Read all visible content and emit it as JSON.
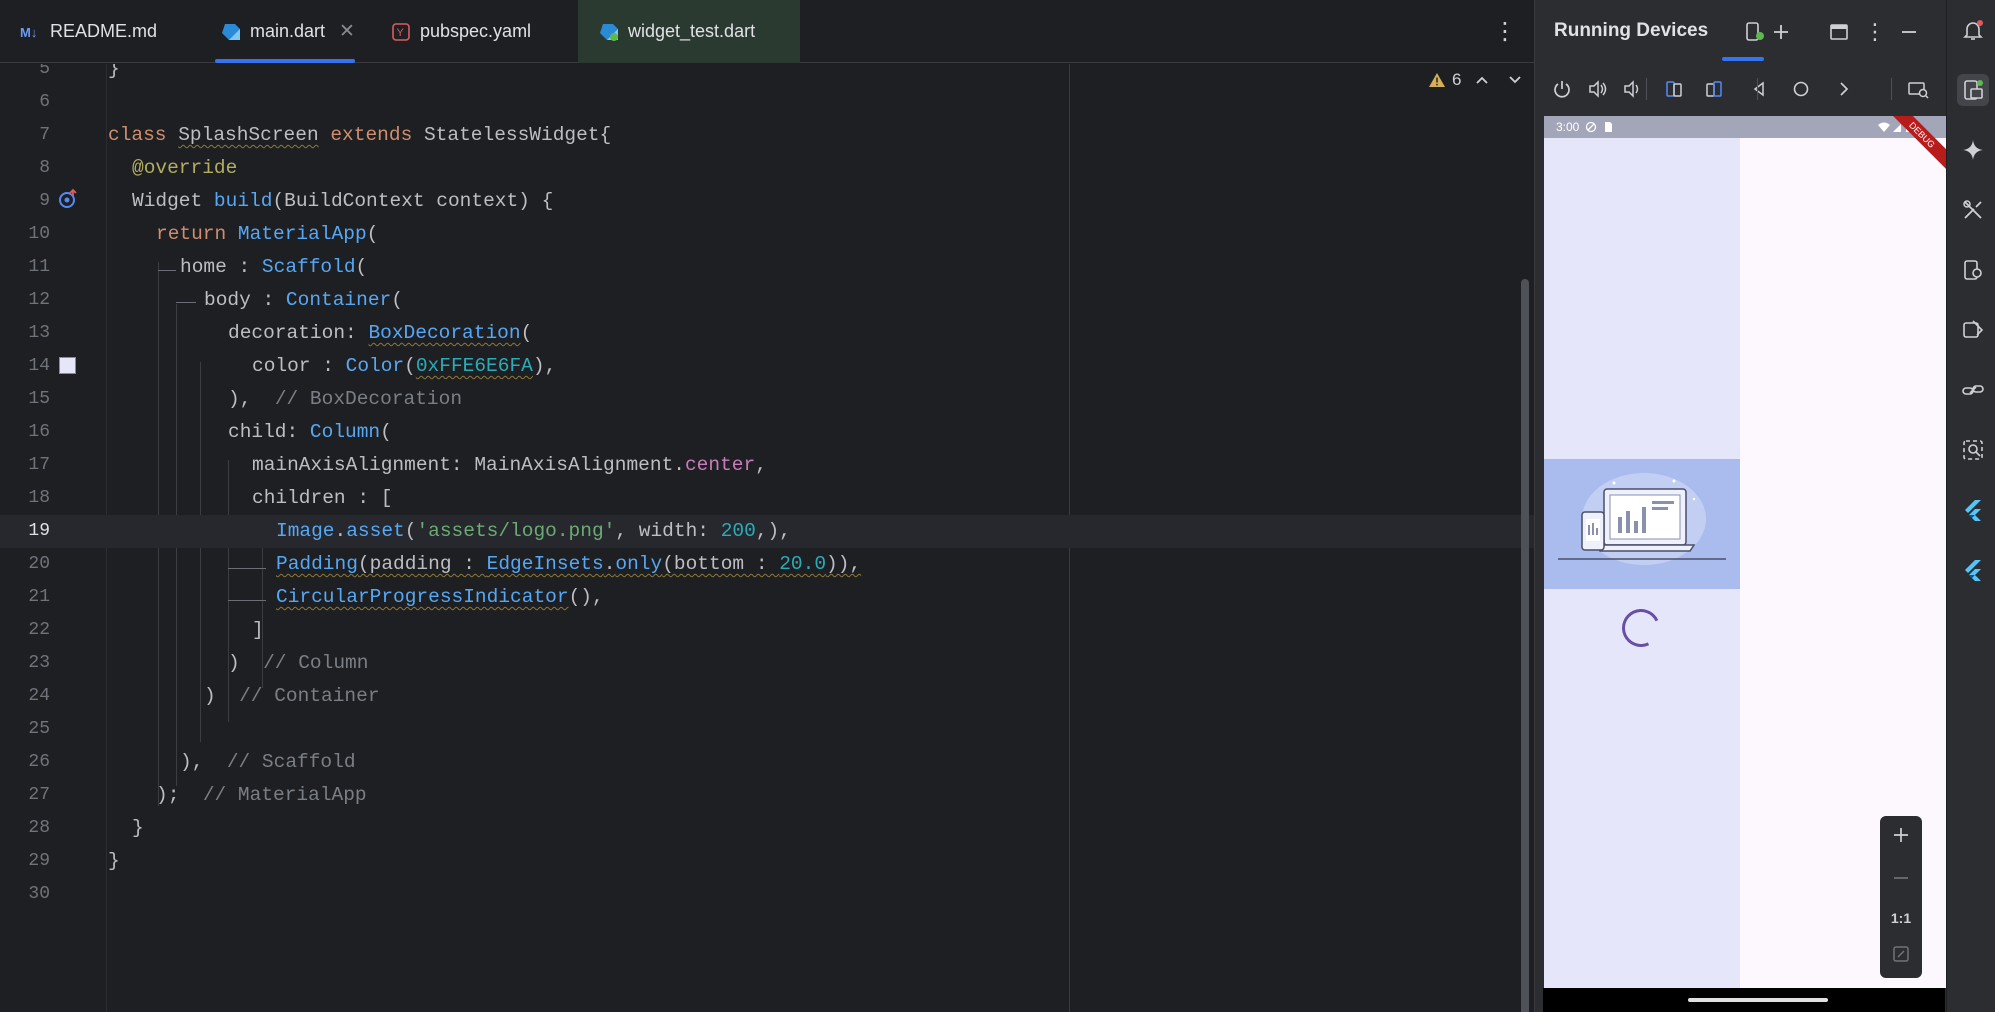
{
  "tabs": [
    {
      "label": "README.md",
      "icon": "markdown-icon"
    },
    {
      "label": "main.dart",
      "icon": "dart-icon",
      "active": true
    },
    {
      "label": "pubspec.yaml",
      "icon": "yaml-icon"
    },
    {
      "label": "widget_test.dart",
      "icon": "dart-icon"
    }
  ],
  "editor": {
    "warning_count": "6",
    "current_line": 19,
    "line_numbers": [
      "5",
      "6",
      "7",
      "8",
      "9",
      "10",
      "11",
      "12",
      "13",
      "14",
      "15",
      "16",
      "17",
      "18",
      "19",
      "20",
      "21",
      "22",
      "23",
      "24",
      "25",
      "26",
      "27",
      "28",
      "29",
      "30"
    ],
    "code": {
      "l5": "}",
      "l7_kw1": "class",
      "l7_name": "SplashScreen",
      "l7_kw2": "extends",
      "l7_rest": "StatelessWidget{",
      "l8": "@override",
      "l9_type": "Widget",
      "l9_fn": "build",
      "l9_rest": "(BuildContext context) {",
      "l10_kw": "return",
      "l10_cls": "MaterialApp",
      "l10_rest": "(",
      "l11_a": "home : ",
      "l11_cls": "Scaffold",
      "l11_rest": "(",
      "l12_a": "body : ",
      "l12_cls": "Container",
      "l12_rest": "(",
      "l13_a": "decoration: ",
      "l13_cls": "BoxDecoration",
      "l13_rest": "(",
      "l14_a": "color : ",
      "l14_cls": "Color",
      "l14_p1": "(",
      "l14_num": "0xFFE6E6FA",
      "l14_rest": "),",
      "l15_a": "),",
      "l15_cm": "// BoxDecoration",
      "l16_a": "child: ",
      "l16_cls": "Column",
      "l16_rest": "(",
      "l17_a": "mainAxisAlignment: MainAxisAlignment.",
      "l17_prop": "center",
      "l17_rest": ",",
      "l18": "children : [",
      "l19_cls": "Image",
      "l19_dot": ".",
      "l19_fn": "asset",
      "l19_p": "(",
      "l19_str": "'assets/logo.png'",
      "l19_mid": ", width: ",
      "l19_num": "200",
      "l19_rest": ",),",
      "l20_cls": "Padding",
      "l20_a": "(padding : ",
      "l20_cls2": "EdgeInsets",
      "l20_dot": ".",
      "l20_fn": "only",
      "l20_b": "(bottom : ",
      "l20_num": "20.0",
      "l20_rest": ")),",
      "l21_cls": "CircularProgressIndicator",
      "l21_rest": "(),",
      "l22": "]",
      "l23_a": ")",
      "l23_cm": "// Column",
      "l24_a": ")",
      "l24_cm": "// Container",
      "l26_a": "),",
      "l26_cm": "// Scaffold",
      "l27_a": ");",
      "l27_cm": "// MaterialApp",
      "l28": "}",
      "l29": "}"
    }
  },
  "devices_panel": {
    "title": "Running Devices",
    "status_time": "3:00",
    "debug_label": "DEBUG",
    "zoom_ratio": "1:1",
    "app_background": "#E6E6FA",
    "accent": "#3574F0"
  }
}
